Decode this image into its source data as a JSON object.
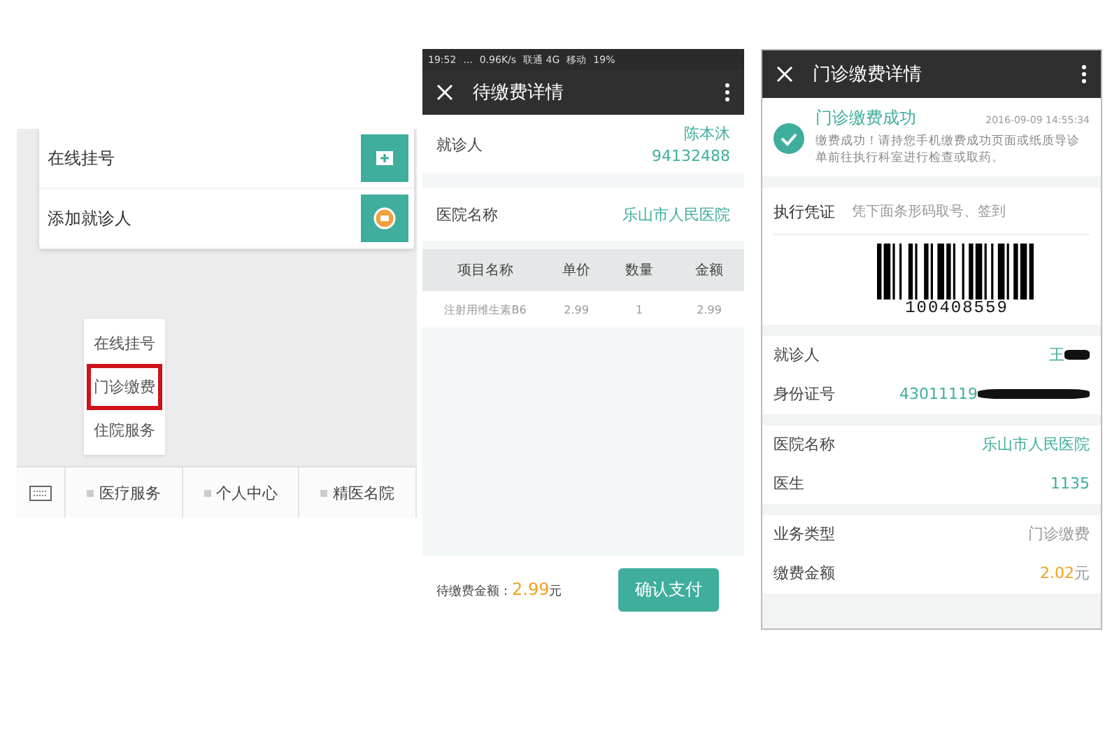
{
  "menu_screen": {
    "cards": [
      {
        "label": "在线挂号",
        "kind": "kit"
      },
      {
        "label": "添加就诊人",
        "kind": "badge"
      }
    ],
    "popup_menu": [
      {
        "label": "在线挂号",
        "selected": false
      },
      {
        "label": "门诊缴费",
        "selected": true
      },
      {
        "label": "住院服务",
        "selected": false
      }
    ],
    "bottom_nav": [
      "医疗服务",
      "个人中心",
      "精医名院"
    ]
  },
  "pending_screen": {
    "status_bar": [
      "19:52",
      "...",
      "0.96K/s",
      "联通 4G",
      "移动",
      "19%"
    ],
    "title": "待缴费详情",
    "patient": {
      "label": "就诊人",
      "name": "陈本沐",
      "number": "94132488"
    },
    "hospital": {
      "label": "医院名称",
      "value": "乐山市人民医院"
    },
    "table": {
      "columns": [
        "项目名称",
        "单价",
        "数量",
        "金额"
      ],
      "rows": [
        [
          "注射用维生素B6",
          "2.99",
          "1",
          "2.99"
        ]
      ]
    },
    "footer": {
      "label": "待缴费金额：",
      "amount": "2.99",
      "unit": "元",
      "button": "确认支付"
    }
  },
  "paid_screen": {
    "title": "门诊缴费详情",
    "success": {
      "title": "门诊缴费成功",
      "time": "2016-09-09 14:55:34",
      "message": "缴费成功！请持您手机缴费成功页面或纸质导诊单前往执行科室进行检查或取药。"
    },
    "voucher": {
      "label": "执行凭证",
      "hint": "凭下面条形码取号、签到",
      "code": "100408559"
    },
    "groups": [
      [
        {
          "label": "就诊人",
          "value": "王",
          "kind": "accent",
          "redacted": true
        },
        {
          "label": "身份证号",
          "value": "43011119",
          "kind": "accent",
          "redacted": true
        }
      ],
      [
        {
          "label": "医院名称",
          "value": "乐山市人民医院",
          "kind": "accent",
          "redacted": false
        },
        {
          "label": "医生",
          "value": "1135",
          "kind": "accent",
          "redacted": false
        }
      ],
      [
        {
          "label": "业务类型",
          "value": "门诊缴费",
          "kind": "muted",
          "redacted": false
        },
        {
          "label": "缴费金额",
          "value": "2.02",
          "unit": "元",
          "kind": "price",
          "redacted": false
        }
      ]
    ]
  }
}
